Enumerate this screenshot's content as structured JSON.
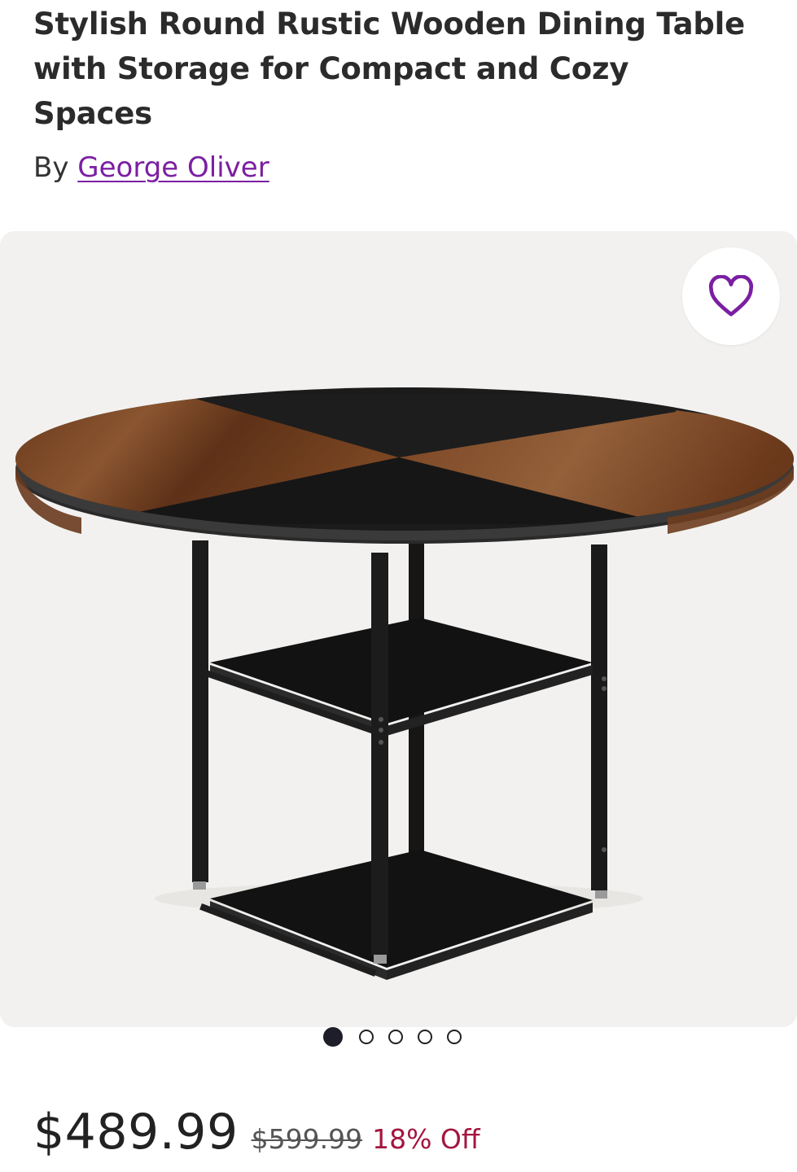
{
  "product": {
    "title": "Stylish Round Rustic Wooden Dining Table with Storage for Compact and Cozy Spaces",
    "by_label": "By",
    "brand": "George Oliver"
  },
  "gallery": {
    "image_alt": "Round rustic wooden dining table with two storage shelves",
    "favorite_icon": "heart-icon",
    "image_count": 5,
    "active_index": 0
  },
  "pricing": {
    "price": "$489.99",
    "original_price": "$599.99",
    "discount": "18% Off"
  },
  "colors": {
    "brand_purple": "#7b1fa2",
    "discount_red": "#a3163f",
    "gallery_bg": "#f2f1ef"
  }
}
